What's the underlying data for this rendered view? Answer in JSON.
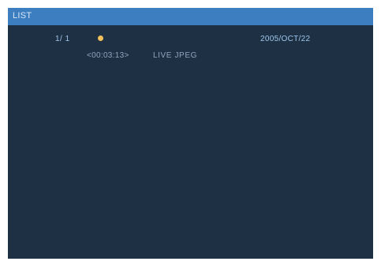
{
  "header": {
    "title": "LIST"
  },
  "status": {
    "counter": "1/ 1",
    "date": "2005/OCT/22"
  },
  "selected_item": {
    "timecode": "<00:03:13>",
    "format": "LIVE JPEG"
  },
  "colors": {
    "background": "#1e3044",
    "title_bar": "#3d7ec0",
    "accent_text": "#9fc6ec",
    "indicator": "#f2c15a"
  }
}
